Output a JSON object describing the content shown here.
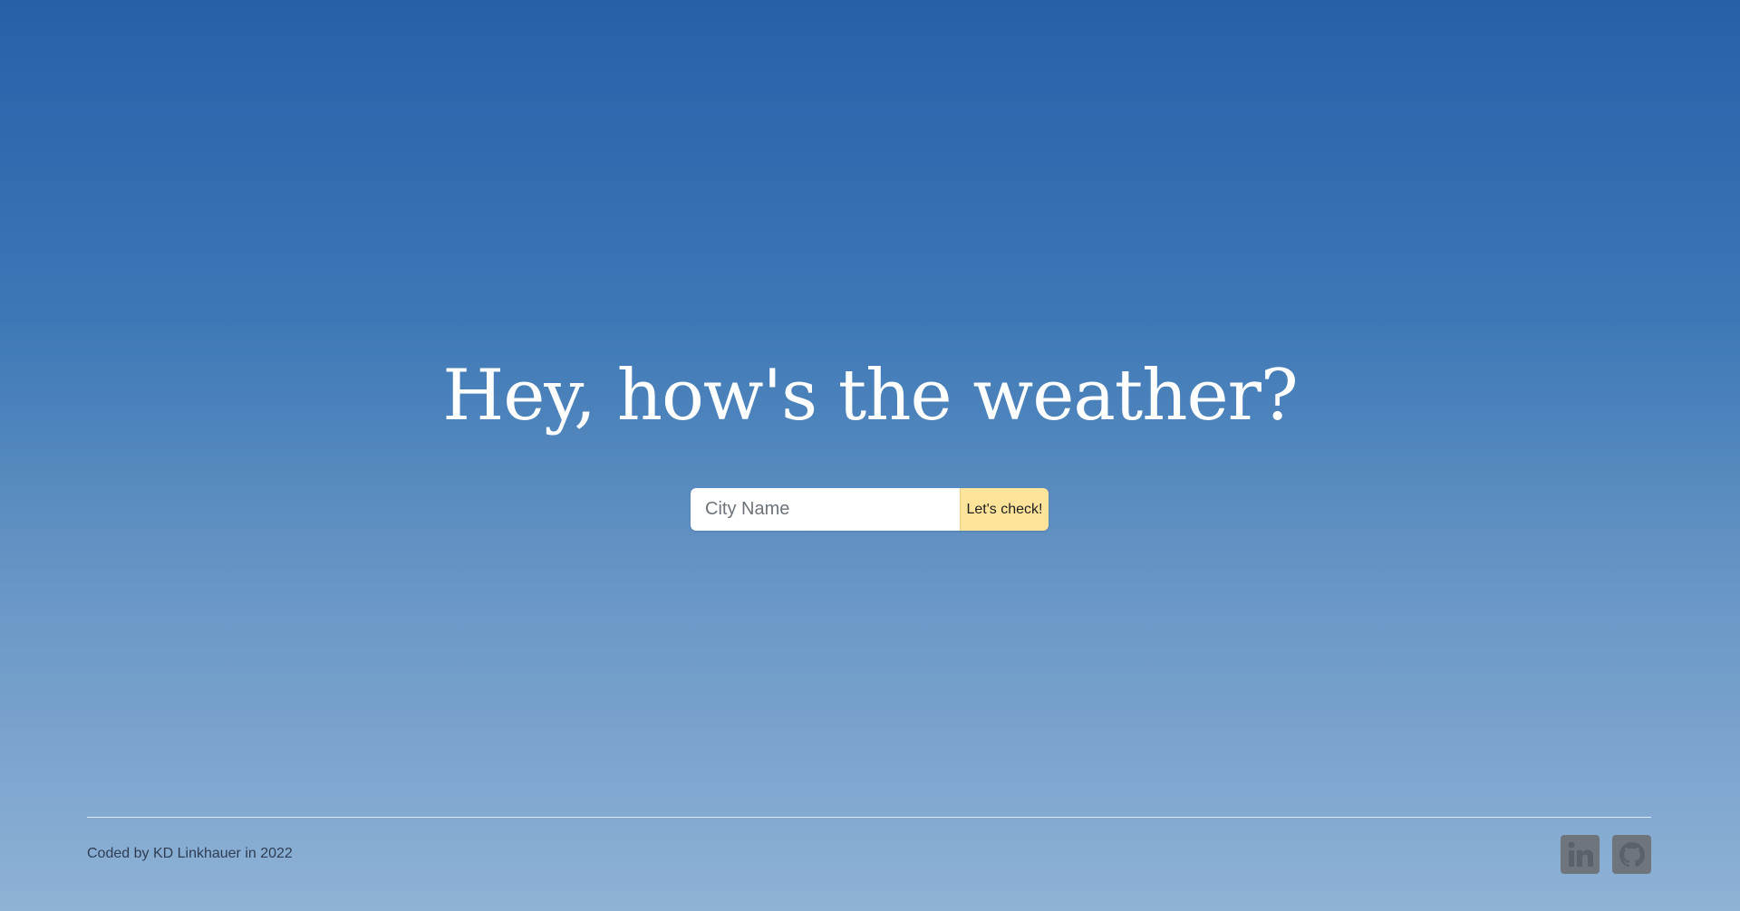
{
  "hero": {
    "headline": "Hey, how's the weather?"
  },
  "search": {
    "placeholder": "City Name",
    "value": "",
    "button_label": "Let's check!"
  },
  "footer": {
    "credit": "Coded by KD Linkhauer in 2022",
    "links": [
      {
        "icon": "linkedin-icon"
      },
      {
        "icon": "github-icon"
      }
    ]
  },
  "colors": {
    "gradient_top": "#2660a9",
    "gradient_bottom": "#8fb2d6",
    "button_accent": "#fde49a",
    "icon_gray": "#6f757c"
  }
}
